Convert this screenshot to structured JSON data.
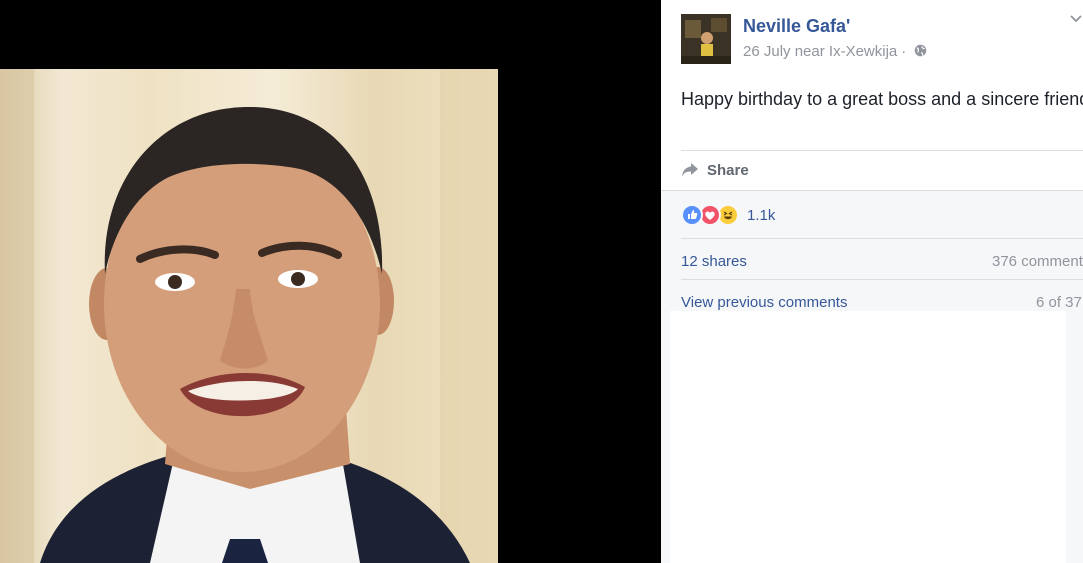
{
  "post": {
    "author": "Neville Gafa'",
    "date": "26 July",
    "location_prefix": "near",
    "location": "Ix-Xewkija",
    "separator": "·",
    "privacy_icon": "globe-icon",
    "text": "Happy birthday to a great boss and a sincere friend."
  },
  "actions": {
    "share_label": "Share"
  },
  "reactions": {
    "types": [
      "like",
      "love",
      "haha"
    ],
    "colors": {
      "like": "#5890ff",
      "love": "#f25268",
      "haha": "#fbcd3c"
    },
    "count": "1.1k"
  },
  "stats": {
    "shares": "12 shares",
    "comments": "376 comment"
  },
  "comments": {
    "view_previous": "View previous comments",
    "pager": "6 of 37"
  },
  "colors": {
    "link": "#365899",
    "secondary_text": "#90949c"
  }
}
